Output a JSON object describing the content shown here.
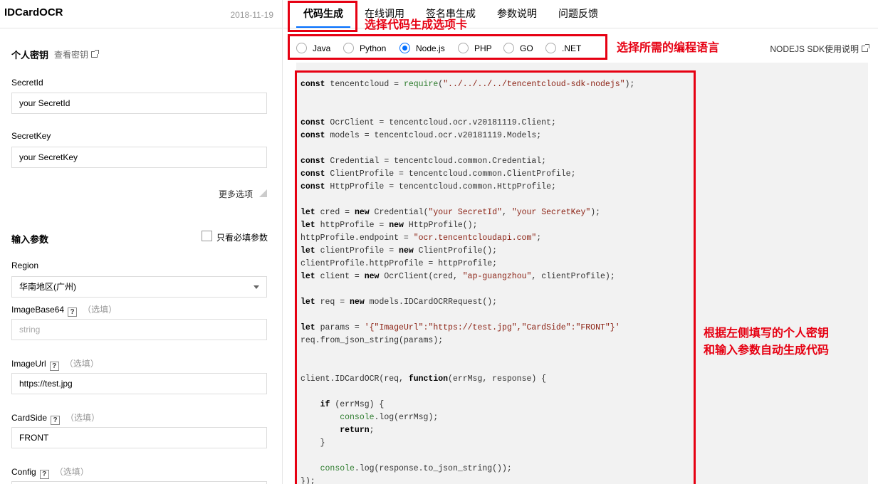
{
  "app": {
    "title": "IDCardOCR",
    "date": "2018-11-19"
  },
  "secret": {
    "section_title": "个人密钥",
    "view_link": "查看密钥",
    "secret_id_label": "SecretId",
    "secret_id_value": "your SecretId",
    "secret_key_label": "SecretKey",
    "secret_key_value": "your SecretKey",
    "more_options": "更多选项"
  },
  "params": {
    "section_title": "输入参数",
    "required_only_label": "只看必填参数",
    "region_label": "Region",
    "region_value": "华南地区(广州)",
    "image_base64_label": "ImageBase64",
    "image_base64_optional": "（选填）",
    "image_base64_placeholder": "string",
    "image_url_label": "ImageUrl",
    "image_url_optional": "（选填）",
    "image_url_value": "https://test.jpg",
    "card_side_label": "CardSide",
    "card_side_optional": "（选填）",
    "card_side_value": "FRONT",
    "config_label": "Config",
    "config_optional": "（选填）",
    "help_glyph": "?"
  },
  "tabs": [
    {
      "label": "代码生成",
      "active": true
    },
    {
      "label": "在线调用"
    },
    {
      "label": "签名串生成"
    },
    {
      "label": "参数说明"
    },
    {
      "label": "问题反馈"
    }
  ],
  "languages": [
    {
      "label": "Java",
      "selected": false
    },
    {
      "label": "Python",
      "selected": false
    },
    {
      "label": "Node.js",
      "selected": true
    },
    {
      "label": "PHP",
      "selected": false
    },
    {
      "label": "GO",
      "selected": false
    },
    {
      "label": ".NET",
      "selected": false
    }
  ],
  "sdk_link": "NODEJS SDK使用说明",
  "code": {
    "l1a": "const",
    "l1b": " tencentcloud = ",
    "l1c": "require",
    "l1d": "(",
    "l1e": "\"../../../../tencentcloud-sdk-nodejs\"",
    "l1f": ");",
    "l2a": "const",
    "l2b": " OcrClient = tencentcloud.ocr.v20181119.Client;",
    "l3a": "const",
    "l3b": " models = tencentcloud.ocr.v20181119.Models;",
    "l4a": "const",
    "l4b": " Credential = tencentcloud.common.Credential;",
    "l5a": "const",
    "l5b": " ClientProfile = tencentcloud.common.ClientProfile;",
    "l6a": "const",
    "l6b": " HttpProfile = tencentcloud.common.HttpProfile;",
    "l7a": "let",
    "l7b": " cred = ",
    "l7c": "new",
    "l7d": " Credential(",
    "l7e": "\"your SecretId\"",
    "l7f": ", ",
    "l7g": "\"your SecretKey\"",
    "l7h": ");",
    "l8a": "let",
    "l8b": " httpProfile = ",
    "l8c": "new",
    "l8d": " HttpProfile();",
    "l9a": "httpProfile.endpoint = ",
    "l9b": "\"ocr.tencentcloudapi.com\"",
    "l9c": ";",
    "l10a": "let",
    "l10b": " clientProfile = ",
    "l10c": "new",
    "l10d": " ClientProfile();",
    "l11a": "clientProfile.httpProfile = httpProfile;",
    "l12a": "let",
    "l12b": " client = ",
    "l12c": "new",
    "l12d": " OcrClient(cred, ",
    "l12e": "\"ap-guangzhou\"",
    "l12f": ", clientProfile);",
    "l13a": "let",
    "l13b": " req = ",
    "l13c": "new",
    "l13d": " models.IDCardOCRRequest();",
    "l14a": "let",
    "l14b": " params = ",
    "l14c": "'{\"ImageUrl\":\"https://test.jpg\",\"CardSide\":\"FRONT\"}'",
    "l15a": "req.from_json_string(params);",
    "l16a": "client.IDCardOCR(req, ",
    "l16b": "function",
    "l16c": "(errMsg, response) {",
    "l17a": "    ",
    "l17b": "if",
    "l17c": " (errMsg) {",
    "l18a": "        ",
    "l18b": "console",
    "l18c": ".log(errMsg);",
    "l19a": "        ",
    "l19b": "return",
    "l19c": ";",
    "l20a": "    }",
    "l21a": "    ",
    "l21b": "console",
    "l21c": ".log(response.to_json_string());",
    "l22a": "});"
  },
  "annotations": {
    "tab_note": "选择代码生成选项卡",
    "lang_note": "选择所需的编程语言",
    "code_note_1": "根据左侧填写的个人密钥",
    "code_note_2": "和输入参数自动生成代码",
    "highlight_color": "#e60012"
  }
}
